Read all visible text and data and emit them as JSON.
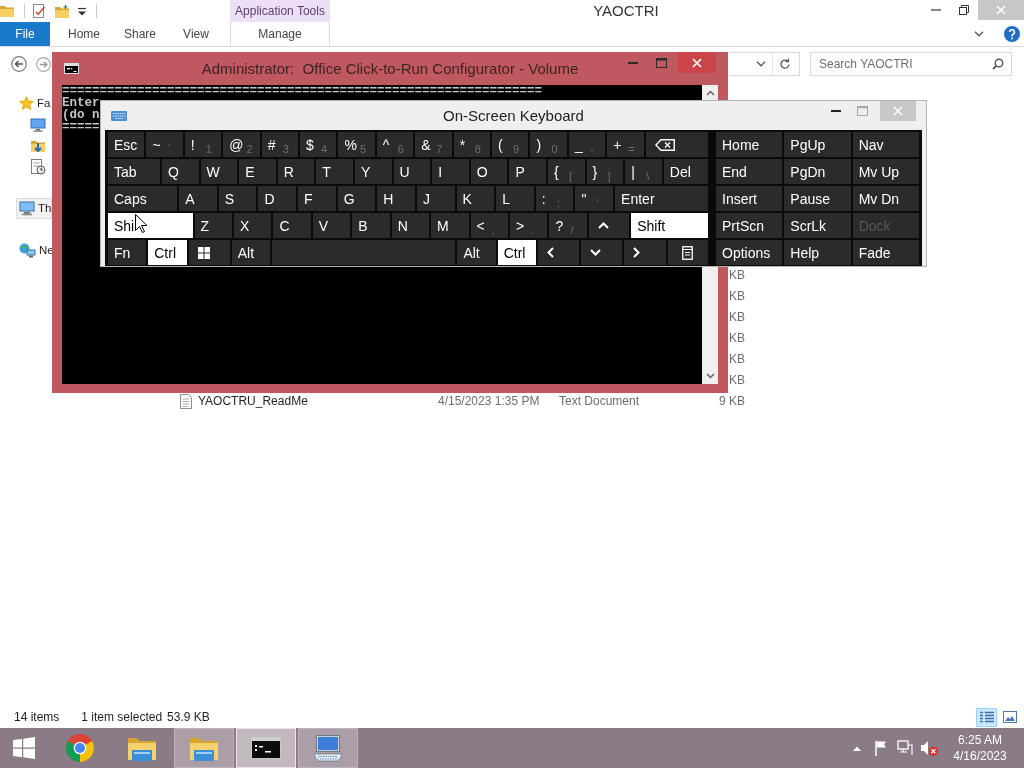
{
  "explorer": {
    "title": "YAOCTRI",
    "context_header": "Application Tools",
    "ribbon_tabs": [
      {
        "label": "File",
        "kind": "file"
      },
      {
        "label": "Home",
        "kind": "tab"
      },
      {
        "label": "Share",
        "kind": "tab"
      },
      {
        "label": "View",
        "kind": "tab"
      },
      {
        "label": "Manage",
        "kind": "contextual"
      }
    ],
    "search": {
      "placeholder": "Search YAOCTRI"
    },
    "navigation": [
      {
        "label": "Fa",
        "kind": "favorites",
        "selected": false,
        "children": [
          {
            "kind": "desktop",
            "selected": false
          },
          {
            "kind": "downloads",
            "selected": false
          },
          {
            "kind": "recent",
            "selected": false
          }
        ]
      },
      {
        "label": "Th",
        "kind": "computer",
        "selected": true
      },
      {
        "label": "Ne",
        "kind": "network",
        "selected": false
      }
    ],
    "files": [
      {
        "size": "KB"
      },
      {
        "size": "KB"
      },
      {
        "size": "KB"
      },
      {
        "size": "KB"
      },
      {
        "size": "KB"
      },
      {
        "size": "KB"
      },
      {
        "name": "YAOCTRU_ReadMe",
        "date_modified": "4/15/2023 1:35 PM",
        "type": "Text Document",
        "size": "9 KB"
      }
    ],
    "status_bar": {
      "item_count": "14 items",
      "selection": "1 item selected",
      "selection_size": "53.9 KB",
      "views": [
        {
          "kind": "details",
          "selected": true
        },
        {
          "kind": "large-icons",
          "selected": false
        }
      ]
    }
  },
  "console": {
    "title": "Administrator:  Office Click-to-Run Configurator - Volume",
    "lines": [
      "================================================================",
      "Enter",
      "(do n",
      "====="
    ]
  },
  "keyboard": {
    "title": "On-Screen Keyboard",
    "rows": [
      {
        "keys": [
          {
            "kind": "key",
            "label": "Esc",
            "pressed": false
          },
          {
            "kind": "dual",
            "label": "~",
            "sub": "`",
            "pressed": false
          },
          {
            "kind": "dual",
            "label": "!",
            "sub": "1",
            "pressed": false
          },
          {
            "kind": "dual",
            "label": "@",
            "sub": "2",
            "pressed": false
          },
          {
            "kind": "dual",
            "label": "#",
            "sub": "3",
            "pressed": false
          },
          {
            "kind": "dual",
            "label": "$",
            "sub": "4",
            "pressed": false
          },
          {
            "kind": "dual",
            "label": "%",
            "sub": "5",
            "pressed": false
          },
          {
            "kind": "dual",
            "label": "^",
            "sub": "6",
            "pressed": false
          },
          {
            "kind": "dual",
            "label": "&",
            "sub": "7",
            "pressed": false
          },
          {
            "kind": "dual",
            "label": "*",
            "sub": "8",
            "pressed": false
          },
          {
            "kind": "dual",
            "label": "(",
            "sub": "9",
            "pressed": false
          },
          {
            "kind": "dual",
            "label": ")",
            "sub": "0",
            "pressed": false
          },
          {
            "kind": "dual",
            "label": "_",
            "sub": "-",
            "pressed": false
          },
          {
            "kind": "dual",
            "label": "+",
            "sub": "=",
            "pressed": false
          },
          {
            "kind": "backspace",
            "pressed": false
          }
        ]
      },
      {
        "keys": [
          {
            "kind": "key",
            "label": "Tab",
            "pressed": false
          },
          {
            "kind": "key",
            "label": "Q",
            "pressed": false
          },
          {
            "kind": "key",
            "label": "W",
            "pressed": false
          },
          {
            "kind": "key",
            "label": "E",
            "pressed": false
          },
          {
            "kind": "key",
            "label": "R",
            "pressed": false
          },
          {
            "kind": "key",
            "label": "T",
            "pressed": false
          },
          {
            "kind": "key",
            "label": "Y",
            "pressed": false
          },
          {
            "kind": "key",
            "label": "U",
            "pressed": false
          },
          {
            "kind": "key",
            "label": "I",
            "pressed": false
          },
          {
            "kind": "key",
            "label": "O",
            "pressed": false
          },
          {
            "kind": "key",
            "label": "P",
            "pressed": false
          },
          {
            "kind": "dual",
            "label": "{",
            "sub": "[",
            "pressed": false
          },
          {
            "kind": "dual",
            "label": "}",
            "sub": "]",
            "pressed": false
          },
          {
            "kind": "dual",
            "label": "|",
            "sub": "\\",
            "pressed": false
          },
          {
            "kind": "key",
            "label": "Del",
            "pressed": false
          }
        ]
      },
      {
        "keys": [
          {
            "kind": "key",
            "label": "Caps",
            "pressed": false
          },
          {
            "kind": "key",
            "label": "A",
            "pressed": false
          },
          {
            "kind": "key",
            "label": "S",
            "pressed": false
          },
          {
            "kind": "key",
            "label": "D",
            "pressed": false
          },
          {
            "kind": "key",
            "label": "F",
            "pressed": false
          },
          {
            "kind": "key",
            "label": "G",
            "pressed": false
          },
          {
            "kind": "key",
            "label": "H",
            "pressed": false
          },
          {
            "kind": "key",
            "label": "J",
            "pressed": false
          },
          {
            "kind": "key",
            "label": "K",
            "pressed": false
          },
          {
            "kind": "key",
            "label": "L",
            "pressed": false
          },
          {
            "kind": "dual",
            "label": ":",
            "sub": ";",
            "pressed": false
          },
          {
            "kind": "dual",
            "label": "\"",
            "sub": "'",
            "pressed": false
          },
          {
            "kind": "key",
            "label": "Enter",
            "pressed": false
          }
        ]
      },
      {
        "keys": [
          {
            "kind": "key",
            "label": "Shi",
            "pressed": true
          },
          {
            "kind": "key",
            "label": "Z",
            "pressed": false
          },
          {
            "kind": "key",
            "label": "X",
            "pressed": false
          },
          {
            "kind": "key",
            "label": "C",
            "pressed": false
          },
          {
            "kind": "key",
            "label": "V",
            "pressed": false
          },
          {
            "kind": "key",
            "label": "B",
            "pressed": false
          },
          {
            "kind": "key",
            "label": "N",
            "pressed": false
          },
          {
            "kind": "key",
            "label": "M",
            "pressed": false
          },
          {
            "kind": "dual",
            "label": "<",
            "sub": ",",
            "pressed": false
          },
          {
            "kind": "dual",
            "label": ">",
            "sub": ".",
            "pressed": false
          },
          {
            "kind": "dual",
            "label": "?",
            "sub": "/",
            "pressed": false
          },
          {
            "kind": "up",
            "pressed": false
          },
          {
            "kind": "key",
            "label": "Shift",
            "pressed": true
          }
        ]
      },
      {
        "keys": [
          {
            "kind": "key",
            "label": "Fn",
            "pressed": false
          },
          {
            "kind": "key",
            "label": "Ctrl",
            "pressed": true
          },
          {
            "kind": "windows",
            "pressed": false
          },
          {
            "kind": "key",
            "label": "Alt",
            "pressed": false
          },
          {
            "kind": "space",
            "pressed": false
          },
          {
            "kind": "key",
            "label": "Alt",
            "pressed": false
          },
          {
            "kind": "key",
            "label": "Ctrl",
            "pressed": true
          },
          {
            "kind": "left",
            "pressed": false
          },
          {
            "kind": "down",
            "pressed": false
          },
          {
            "kind": "right",
            "pressed": false
          },
          {
            "kind": "menu",
            "pressed": false
          }
        ]
      }
    ],
    "side_keys": [
      {
        "keys": [
          {
            "label": "Home",
            "disabled": false
          },
          {
            "label": "PgUp",
            "disabled": false
          },
          {
            "label": "Nav",
            "disabled": false
          }
        ]
      },
      {
        "keys": [
          {
            "label": "End",
            "disabled": false
          },
          {
            "label": "PgDn",
            "disabled": false
          },
          {
            "label": "Mv Up",
            "disabled": false
          }
        ]
      },
      {
        "keys": [
          {
            "label": "Insert",
            "disabled": false
          },
          {
            "label": "Pause",
            "disabled": false
          },
          {
            "label": "Mv Dn",
            "disabled": false
          }
        ]
      },
      {
        "keys": [
          {
            "label": "PrtScn",
            "disabled": false
          },
          {
            "label": "ScrLk",
            "disabled": false
          },
          {
            "label": "Dock",
            "disabled": true
          }
        ]
      },
      {
        "keys": [
          {
            "label": "Options",
            "disabled": false
          },
          {
            "label": "Help",
            "disabled": false
          },
          {
            "label": "Fade",
            "disabled": false
          }
        ]
      }
    ]
  },
  "taskbar": {
    "buttons": [
      {
        "kind": "browser",
        "running": false,
        "selected": false
      },
      {
        "kind": "folder",
        "running": false,
        "selected": false
      },
      {
        "kind": "folder",
        "running": true,
        "selected": false
      },
      {
        "kind": "console",
        "running": true,
        "selected": true
      },
      {
        "kind": "keyboard",
        "running": true,
        "selected": false
      }
    ],
    "tray_icons": [
      {
        "kind": "show-hidden"
      },
      {
        "kind": "flag"
      },
      {
        "kind": "network"
      }
    ],
    "volume": {
      "muted": true
    },
    "time": "6:25 AM",
    "date": "4/16/2023"
  }
}
